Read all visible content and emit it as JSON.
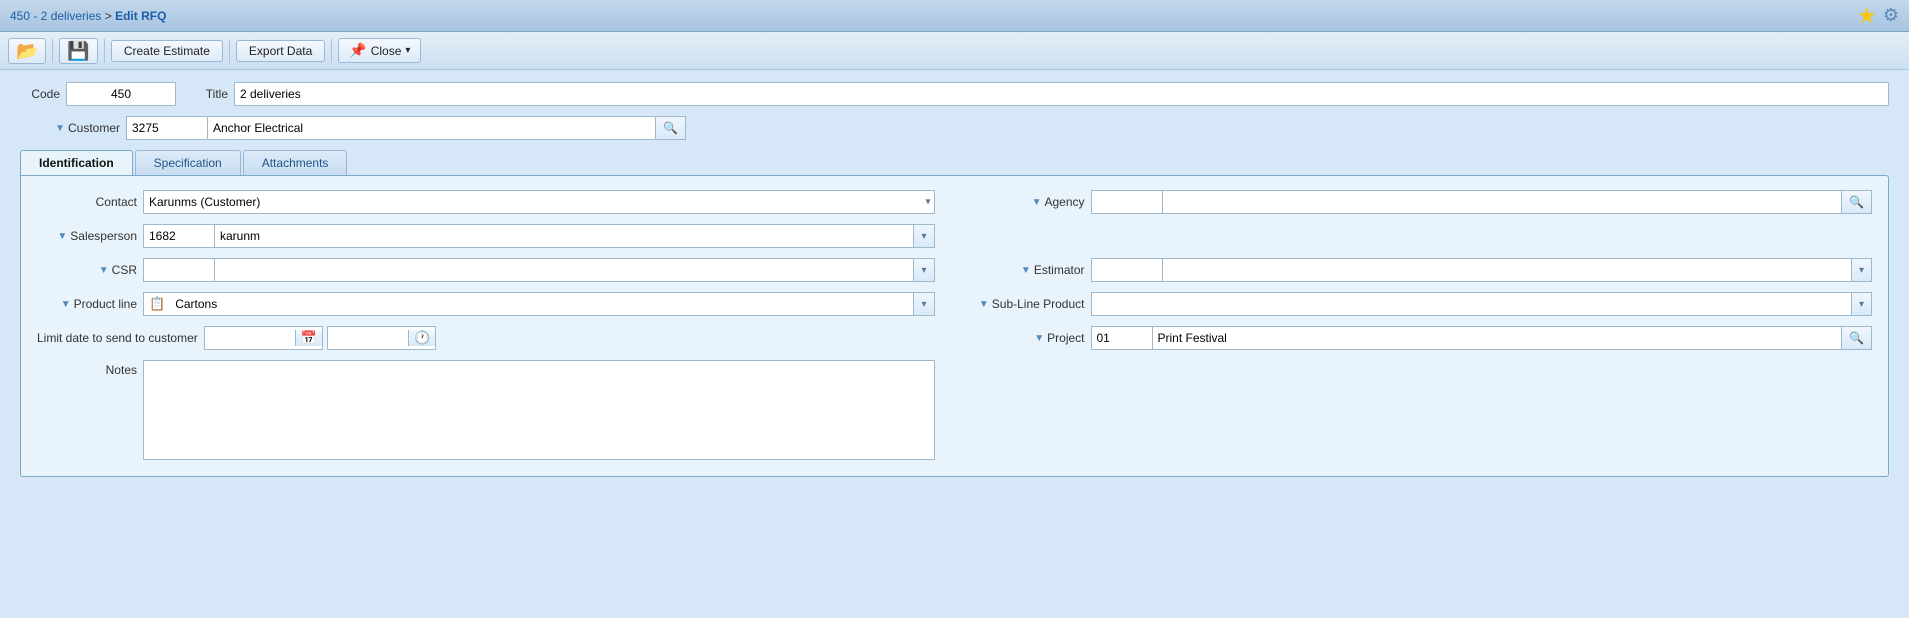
{
  "breadcrumb": {
    "link_text": "450 - 2 deliveries",
    "separator": " > ",
    "current": "Edit RFQ"
  },
  "toolbar": {
    "save_icon": "💾",
    "open_icon": "📂",
    "create_estimate_label": "Create Estimate",
    "export_data_label": "Export Data",
    "close_label": "Close",
    "close_icon": "📌",
    "close_dropdown_arrow": "▾"
  },
  "form": {
    "code_label": "Code",
    "code_value": "450",
    "title_label": "Title",
    "title_value": "2 deliveries",
    "customer_label": "Customer",
    "customer_code": "3275",
    "customer_name": "Anchor Electrical"
  },
  "tabs": [
    {
      "id": "identification",
      "label": "Identification",
      "active": true
    },
    {
      "id": "specification",
      "label": "Specification",
      "active": false
    },
    {
      "id": "attachments",
      "label": "Attachments",
      "active": false
    }
  ],
  "identification": {
    "contact_label": "Contact",
    "contact_value": "Karunms (Customer)",
    "agency_label": "Agency",
    "agency_code": "",
    "agency_name": "",
    "salesperson_label": "Salesperson",
    "salesperson_code": "1682",
    "salesperson_name": "karunm",
    "csr_label": "CSR",
    "csr_code": "",
    "csr_name": "",
    "estimator_label": "Estimator",
    "estimator_code": "",
    "estimator_name": "",
    "product_line_label": "Product line",
    "product_line_icon": "📋",
    "product_line_value": "Cartons",
    "subline_label": "Sub-Line Product",
    "subline_value": "",
    "limit_date_label": "Limit date to send to customer",
    "limit_date_value": "",
    "limit_time_value": "",
    "project_label": "Project",
    "project_code": "01",
    "project_name": "Print Festival",
    "notes_label": "Notes",
    "notes_value": ""
  },
  "icons": {
    "triangle_down": "▼",
    "triangle_right": "▶",
    "search": "🔍",
    "calendar": "📅",
    "clock": "🕐",
    "star": "★",
    "help": "🔧",
    "dropdown_arrow": "▾"
  }
}
